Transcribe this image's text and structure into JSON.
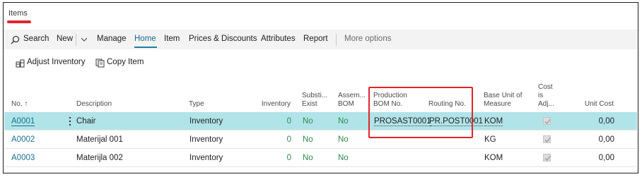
{
  "page": {
    "title": "Items"
  },
  "actions": {
    "search": "Search",
    "new": "New",
    "manage": "Manage",
    "home": "Home",
    "item": "Item",
    "prices": "Prices & Discounts",
    "attributes": "Attributes",
    "report": "Report",
    "more": "More options"
  },
  "home_actions": {
    "adjust": "Adjust Inventory",
    "copy": "Copy Item"
  },
  "columns": {
    "no": "No. ↑",
    "description": "Description",
    "type": "Type",
    "inventory": "Inventory",
    "subst_1": "Substi...",
    "subst_2": "Exist",
    "assem_1": "Assem...",
    "assem_2": "BOM",
    "prod_1": "Production",
    "prod_2": "BOM No.",
    "routing": "Routing No.",
    "base_1": "Base Unit of",
    "base_2": "Measure",
    "cost_1": "Cost",
    "cost_2": "is",
    "cost_3": "Adj...",
    "unit_cost": "Unit Cost"
  },
  "rows": [
    {
      "no": "A0001",
      "description": "Chair",
      "type": "Inventory",
      "inventory": "0",
      "subst": "No",
      "assem": "No",
      "prod_bom": "PROSAST0001",
      "routing": "PR.POST0001",
      "base_uom": "KOM",
      "cost_adj": true,
      "unit_cost": "0,00"
    },
    {
      "no": "A0002",
      "description": "Materijal 001",
      "type": "Inventory",
      "inventory": "0",
      "subst": "No",
      "assem": "No",
      "prod_bom": "",
      "routing": "",
      "base_uom": "KG",
      "cost_adj": true,
      "unit_cost": "0,00"
    },
    {
      "no": "A0003",
      "description": "Materijla 002",
      "type": "Inventory",
      "inventory": "0",
      "subst": "No",
      "assem": "No",
      "prod_bom": "",
      "routing": "",
      "base_uom": "KOM",
      "cost_adj": true,
      "unit_cost": "0,00"
    }
  ],
  "colors": {
    "accent": "#1e7ea0",
    "link": "#1a6f8f",
    "selected_row": "#b1e4e9",
    "highlight": "#e0252b",
    "positive": "#2e8a4e"
  }
}
